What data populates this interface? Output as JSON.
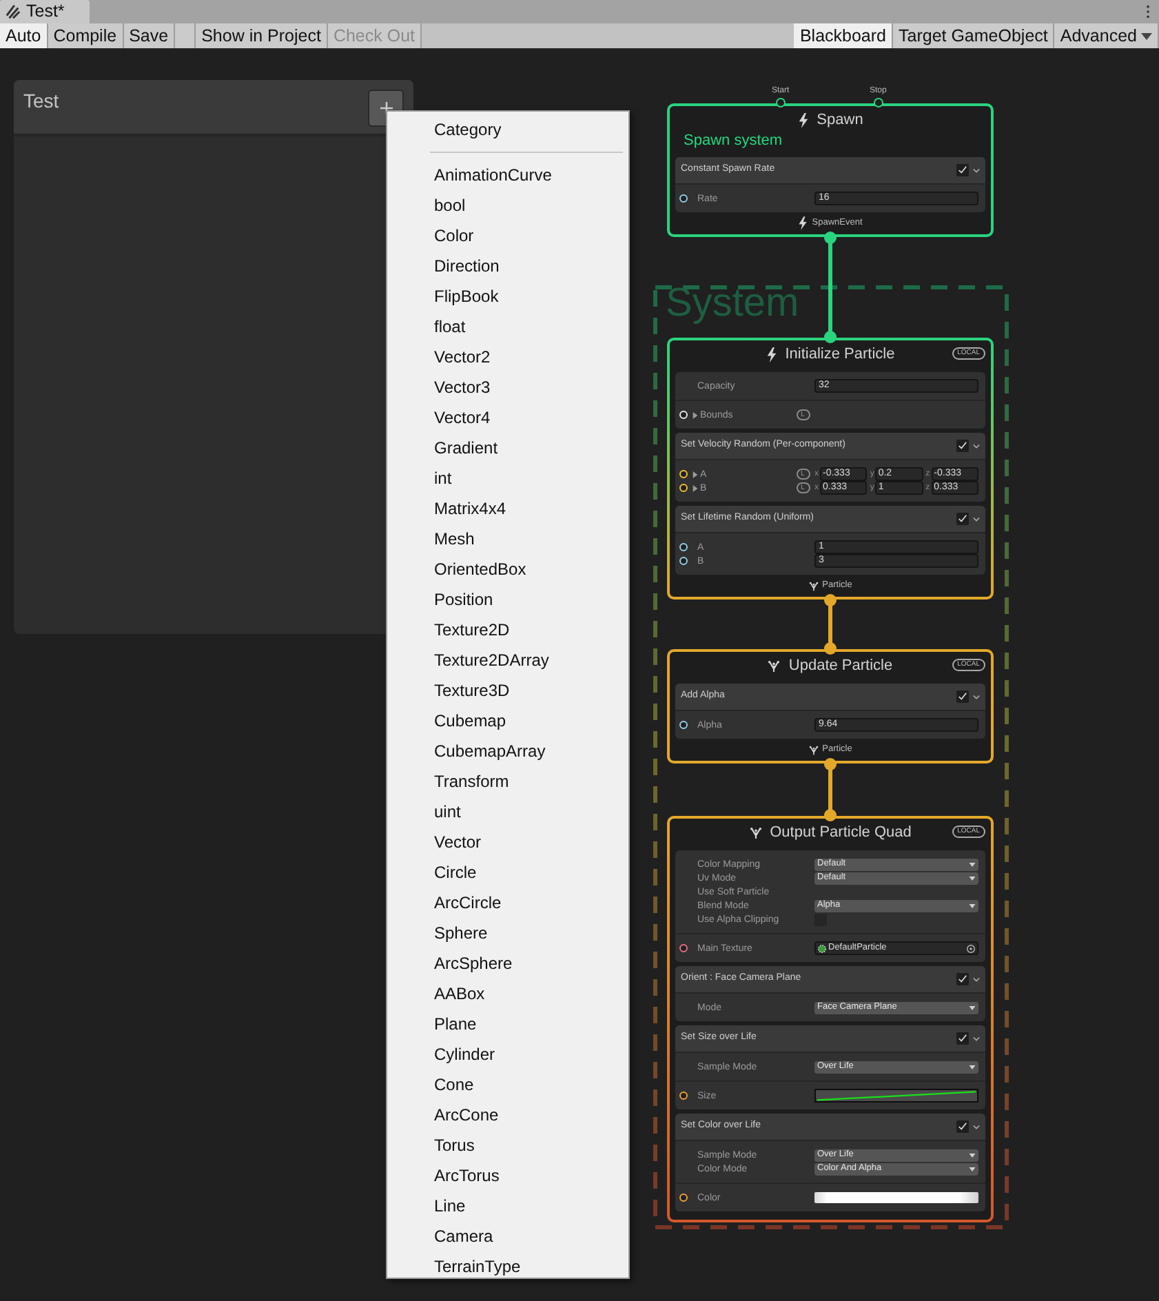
{
  "tab": {
    "title": "Test*"
  },
  "toolbar": {
    "left": [
      {
        "label": "Auto",
        "selected": true,
        "disabled": false
      },
      {
        "label": "Compile",
        "selected": false,
        "disabled": false
      },
      {
        "label": "Save",
        "selected": false,
        "disabled": false
      }
    ],
    "middle": [
      {
        "label": "Show in Project",
        "selected": false,
        "disabled": false
      },
      {
        "label": "Check Out",
        "selected": false,
        "disabled": true
      }
    ],
    "right": [
      {
        "label": "Blackboard",
        "kind": "button",
        "selected": true
      },
      {
        "label": "Target GameObject",
        "kind": "button",
        "selected": false
      },
      {
        "label": "Advanced",
        "kind": "dropdown",
        "selected": false
      }
    ]
  },
  "blackboard": {
    "title": "Test"
  },
  "menu": {
    "header": "Category",
    "items": [
      "AnimationCurve",
      "bool",
      "Color",
      "Direction",
      "FlipBook",
      "float",
      "Vector2",
      "Vector3",
      "Vector4",
      "Gradient",
      "int",
      "Matrix4x4",
      "Mesh",
      "OrientedBox",
      "Position",
      "Texture2D",
      "Texture2DArray",
      "Texture3D",
      "Cubemap",
      "CubemapArray",
      "Transform",
      "uint",
      "Vector",
      "Circle",
      "ArcCircle",
      "Sphere",
      "ArcSphere",
      "AABox",
      "Plane",
      "Cylinder",
      "Cone",
      "ArcCone",
      "Torus",
      "ArcTorus",
      "Line",
      "Camera",
      "TerrainType"
    ]
  },
  "system": {
    "title": "System"
  },
  "nodes": [
    {
      "title": "Spawn",
      "kind": "spawn",
      "color": "#2ad37e",
      "inputs": [
        {
          "label": "Start"
        },
        {
          "label": "Stop"
        }
      ],
      "subtitle": "Spawn system",
      "blocks": [
        {
          "title": "Constant Spawn Rate",
          "enabled": true,
          "rows": [
            {
              "kind": "field",
              "label": "Rate",
              "value": "16",
              "color": "#8fd0e8"
            }
          ]
        }
      ],
      "footer": {
        "kind": "spawn",
        "label": "SpawnEvent"
      }
    },
    {
      "title": "Initialize Particle",
      "kind": "spawn",
      "badge": "LOCAL",
      "color": "#2ad37e",
      "blocks": [
        {
          "rows": [
            {
              "kind": "field",
              "label": "Capacity",
              "value": "32"
            },
            {
              "kind": "space",
              "label": "Bounds",
              "collapsed": true,
              "space": "L",
              "color": "#e6e6e6"
            }
          ]
        },
        {
          "title": "Set Velocity Random (Per-component)",
          "enabled": true,
          "rows": [
            {
              "kind": "vector",
              "label": "A",
              "collapsed": true,
              "space": "L",
              "color": "#f2c12e",
              "components": [
                {
                  "axis": "x",
                  "value": "-0.333"
                },
                {
                  "axis": "y",
                  "value": "0.2"
                },
                {
                  "axis": "z",
                  "value": "-0.333"
                }
              ]
            },
            {
              "kind": "vector",
              "label": "B",
              "collapsed": true,
              "space": "L",
              "color": "#f2c12e",
              "components": [
                {
                  "axis": "x",
                  "value": "0.333"
                },
                {
                  "axis": "y",
                  "value": "1"
                },
                {
                  "axis": "z",
                  "value": "0.333"
                }
              ]
            }
          ]
        },
        {
          "title": "Set Lifetime Random (Uniform)",
          "enabled": true,
          "rows": [
            {
              "kind": "field",
              "label": "A",
              "value": "1",
              "color": "#8fd0e8"
            },
            {
              "kind": "field",
              "label": "B",
              "value": "3",
              "color": "#8fd0e8"
            }
          ]
        }
      ],
      "footer": {
        "kind": "particle",
        "label": "Particle"
      }
    },
    {
      "title": "Update Particle",
      "kind": "particle",
      "badge": "LOCAL",
      "color": "#e3a82a",
      "blocks": [
        {
          "title": "Add Alpha",
          "enabled": true,
          "rows": [
            {
              "kind": "field",
              "label": "Alpha",
              "value": "9.64",
              "color": "#8fd0e8"
            }
          ]
        }
      ],
      "footer": {
        "kind": "particle",
        "label": "Particle"
      }
    },
    {
      "title": "Output Particle Quad",
      "kind": "particle",
      "badge": "LOCAL",
      "color": "#e3a82a",
      "blocks": [
        {
          "rows": [
            {
              "kind": "dropdown",
              "label": "Color Mapping",
              "value": "Default"
            },
            {
              "kind": "dropdown",
              "label": "Uv Mode",
              "value": "Default"
            },
            {
              "kind": "label",
              "label": "Use Soft Particle"
            },
            {
              "kind": "dropdown",
              "label": "Blend Mode",
              "value": "Alpha"
            },
            {
              "kind": "checkbox",
              "label": "Use Alpha Clipping",
              "checked": false
            },
            {
              "kind": "texture",
              "label": "Main Texture",
              "value": "DefaultParticle",
              "color": "#e8707a"
            }
          ]
        },
        {
          "title": "Orient : Face Camera Plane",
          "enabled": true,
          "rows": [
            {
              "kind": "dropdown",
              "label": "Mode",
              "value": "Face Camera Plane"
            }
          ]
        },
        {
          "title": "Set Size over Life",
          "enabled": true,
          "rows": [
            {
              "kind": "dropdown",
              "label": "Sample Mode",
              "value": "Over Life"
            },
            {
              "kind": "curve",
              "label": "Size",
              "color": "#f0a030"
            }
          ]
        },
        {
          "title": "Set Color over Life",
          "enabled": true,
          "rows": [
            {
              "kind": "dropdown",
              "label": "Sample Mode",
              "value": "Over Life"
            },
            {
              "kind": "dropdown",
              "label": "Color Mode",
              "value": "Color And Alpha"
            },
            {
              "kind": "gradient",
              "label": "Color",
              "color": "#f0a030"
            }
          ]
        }
      ]
    }
  ]
}
